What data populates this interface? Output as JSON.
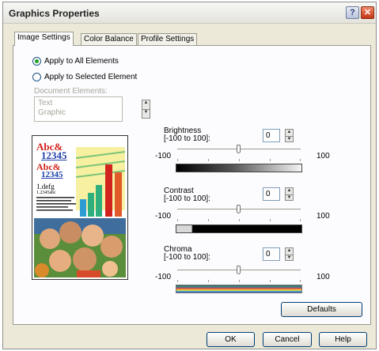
{
  "dialog": {
    "title": "Graphics Properties",
    "help_glyph": "?",
    "close_glyph": "✕"
  },
  "tabs": [
    "Image Settings",
    "Color Balance",
    "Profile Settings"
  ],
  "apply": {
    "all_label": "Apply to All Elements",
    "selected_label": "Apply to Selected Element",
    "selected_option": "all"
  },
  "document_elements": {
    "label": "Document Elements:",
    "items": [
      "Text",
      "Graphic"
    ]
  },
  "preview": {
    "line1": "Abc&",
    "line2": "12345",
    "line3": "Abc&",
    "line4": "12345",
    "line5": "1.defg",
    "line6": "1.2345abc"
  },
  "brightness": {
    "label_line1": "Brightness",
    "label_line2": "[-100 to 100]:",
    "value": "0",
    "min_label": "-100",
    "max_label": "100"
  },
  "contrast": {
    "label_line1": "Contrast",
    "label_line2": "[-100 to 100]:",
    "value": "0",
    "min_label": "-100",
    "max_label": "100"
  },
  "chroma": {
    "label_line1": "Chroma",
    "label_line2": "[-100 to 100]:",
    "value": "0",
    "min_label": "-100",
    "max_label": "100"
  },
  "buttons": {
    "defaults": "Defaults",
    "ok": "OK",
    "cancel": "Cancel",
    "help": "Help"
  },
  "colors": {
    "accent_blue": "#1f3fa8",
    "accent_red": "#d2231c",
    "radio_green": "#21a121",
    "chroma_left": "#3c6b4d"
  }
}
